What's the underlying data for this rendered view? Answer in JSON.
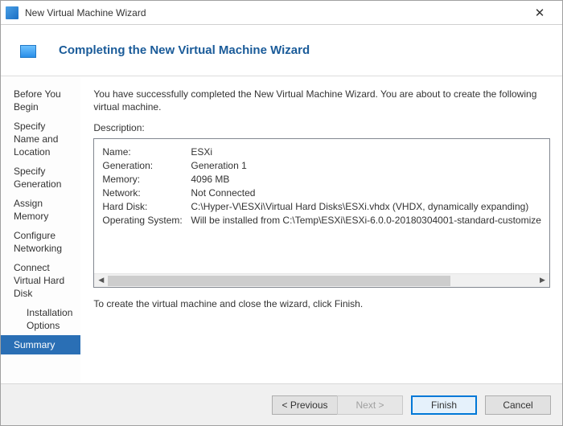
{
  "titlebar": {
    "title": "New Virtual Machine Wizard",
    "close_glyph": "✕"
  },
  "banner": {
    "heading": "Completing the New Virtual Machine Wizard"
  },
  "sidebar": {
    "items": [
      {
        "label": "Before You Begin"
      },
      {
        "label": "Specify Name and Location"
      },
      {
        "label": "Specify Generation"
      },
      {
        "label": "Assign Memory"
      },
      {
        "label": "Configure Networking"
      },
      {
        "label": "Connect Virtual Hard Disk"
      },
      {
        "label": "Installation Options"
      },
      {
        "label": "Summary"
      }
    ]
  },
  "main": {
    "intro": "You have successfully completed the New Virtual Machine Wizard. You are about to create the following virtual machine.",
    "desc_label": "Description:",
    "summary": {
      "name_label": "Name:",
      "name": "ESXi",
      "gen_label": "Generation:",
      "gen": "Generation 1",
      "mem_label": "Memory:",
      "mem": "4096 MB",
      "net_label": "Network:",
      "net": "Not Connected",
      "hdd_label": "Hard Disk:",
      "hdd": "C:\\Hyper-V\\ESXi\\Virtual Hard Disks\\ESXi.vhdx (VHDX, dynamically expanding)",
      "os_label": "Operating System:",
      "os": "Will be installed from C:\\Temp\\ESXi\\ESXi-6.0.0-20180304001-standard-customize"
    },
    "hint": "To create the virtual machine and close the wizard, click Finish."
  },
  "footer": {
    "previous": "< Previous",
    "next": "Next >",
    "finish": "Finish",
    "cancel": "Cancel"
  },
  "scroll": {
    "left_glyph": "◀",
    "right_glyph": "▶"
  }
}
